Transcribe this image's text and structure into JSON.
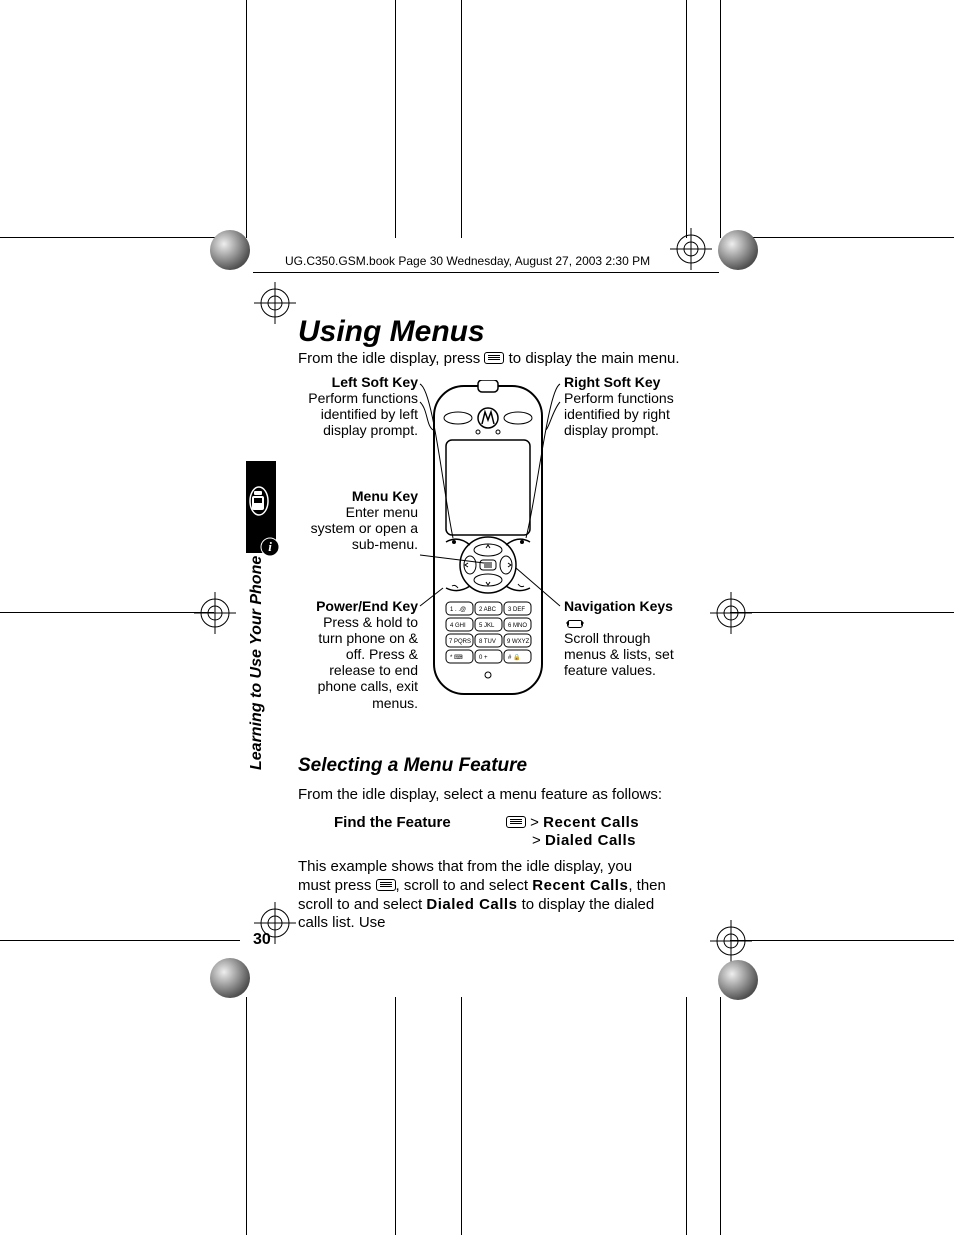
{
  "doc_header": "UG.C350.GSM.book  Page 30  Wednesday, August 27, 2003  2:30 PM",
  "title": "Using Menus",
  "intro_pre": "From the idle display, press ",
  "intro_post": " to display the main menu.",
  "callouts": {
    "left_soft": {
      "heading": "Left Soft Key",
      "body": "Perform functions identified by left display prompt."
    },
    "menu_key": {
      "heading": "Menu Key",
      "body": "Enter menu system or open a sub-menu."
    },
    "power_end": {
      "heading": "Power/End Key",
      "body": "Press & hold to turn phone on & off. Press & release to end phone calls, exit menus."
    },
    "right_soft": {
      "heading": "Right Soft Key",
      "body": "Perform functions identified by right display prompt."
    },
    "nav_keys": {
      "heading": "Navigation Keys ",
      "body": "Scroll through menus & lists, set feature values."
    }
  },
  "side_label": "Learning to Use Your Phone",
  "section_heading": "Selecting a Menu Feature",
  "para_follows": "From the idle display, select a menu feature as follows:",
  "find_feature_label": "Find the Feature",
  "find_feature_line1_sym": " > ",
  "find_feature_line1_txt": "Recent Calls",
  "find_feature_line2_sym": "> ",
  "find_feature_line2_txt": "Dialed Calls",
  "para_last": {
    "p1": "This example shows that from the idle display, you must press ",
    "p2": ", scroll to and select ",
    "b1": "Recent Calls",
    "p3": ", then scroll to and select ",
    "b2": "Dialed Calls",
    "p4": " to display the dialed calls list. Use"
  },
  "page_number": "30"
}
